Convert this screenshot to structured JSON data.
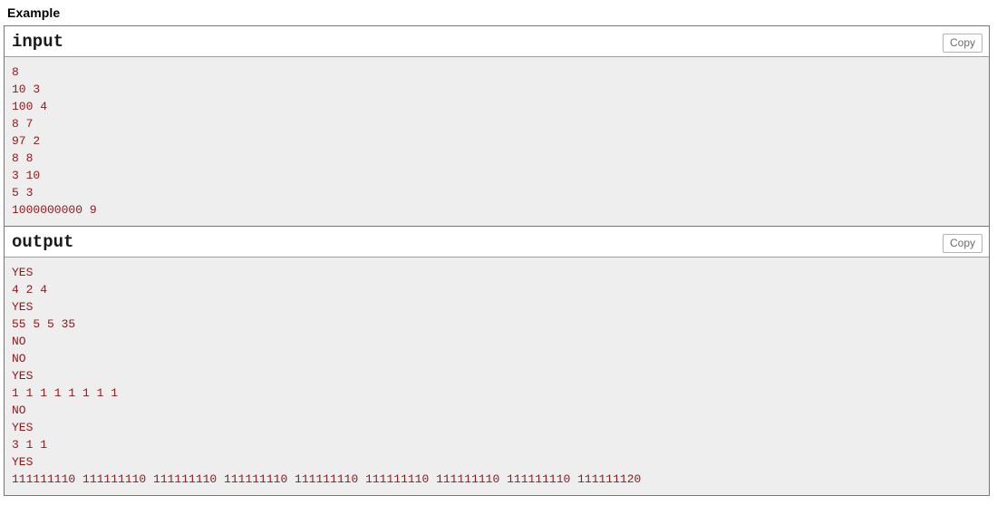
{
  "section": {
    "title": "Example"
  },
  "samples": [
    {
      "header": "input",
      "copy_label": "Copy",
      "lines": [
        "8",
        "10 3",
        "100 4",
        "8 7",
        "97 2",
        "8 8",
        "3 10",
        "5 3",
        "1000000000 9"
      ]
    },
    {
      "header": "output",
      "copy_label": "Copy",
      "lines": [
        "YES",
        "4 2 4",
        "YES",
        "55 5 5 35",
        "NO",
        "NO",
        "YES",
        "1 1 1 1 1 1 1 1",
        "NO",
        "YES",
        "3 1 1",
        "YES",
        "111111110 111111110 111111110 111111110 111111110 111111110 111111110 111111110 111111120"
      ]
    }
  ],
  "colors": {
    "sample_text": "#8b1a1a",
    "sample_background": "#eeeeee",
    "border": "#767676",
    "header_text": "#1a1a1a",
    "copy_text": "#6b6b6b",
    "copy_border": "#b4b4b4"
  }
}
